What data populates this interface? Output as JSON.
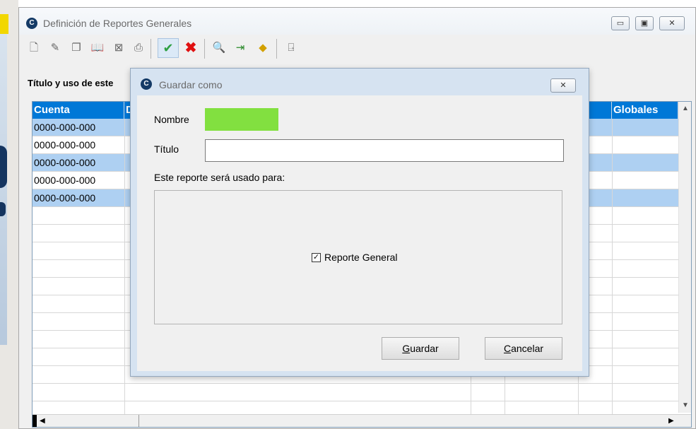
{
  "main_window": {
    "title": "Definición de Reportes Generales",
    "logo_letter": "C",
    "controls": [
      "▭",
      "▣",
      "✕"
    ]
  },
  "toolbar": {
    "icons": [
      "new-doc-icon",
      "edit-icon",
      "copy-icon",
      "open-icon",
      "delete-icon",
      "print-icon",
      "accept-icon",
      "cancel-icon",
      "search-icon",
      "import-icon",
      "clear-icon",
      "exit-icon"
    ],
    "accept_color": "#2ea043",
    "cancel_color": "#e01010"
  },
  "section": {
    "label": "Título y uso de este"
  },
  "grid": {
    "headers": [
      "Cuenta",
      "D",
      "",
      "",
      "",
      "Globales"
    ],
    "header_color": "#0078d7",
    "selected_color": "#aed0f2",
    "rows": [
      {
        "cuenta": "0000-000-000",
        "selected": true
      },
      {
        "cuenta": "0000-000-000",
        "selected": false
      },
      {
        "cuenta": "0000-000-000",
        "selected": true
      },
      {
        "cuenta": "0000-000-000",
        "selected": false
      },
      {
        "cuenta": "0000-000-000",
        "selected": true
      }
    ]
  },
  "dialog": {
    "title": "Guardar como",
    "logo_letter": "C",
    "close": "✕",
    "nombre_label": "Nombre",
    "nombre_value": "",
    "nombre_color": "#82e040",
    "titulo_label": "Título",
    "titulo_value": "",
    "usage_label": "Este reporte será usado para:",
    "checkbox_label": "Reporte General",
    "checkbox_checked": true,
    "guardar_key": "G",
    "guardar_rest": "uardar",
    "cancelar_key": "C",
    "cancelar_rest": "ancelar"
  }
}
